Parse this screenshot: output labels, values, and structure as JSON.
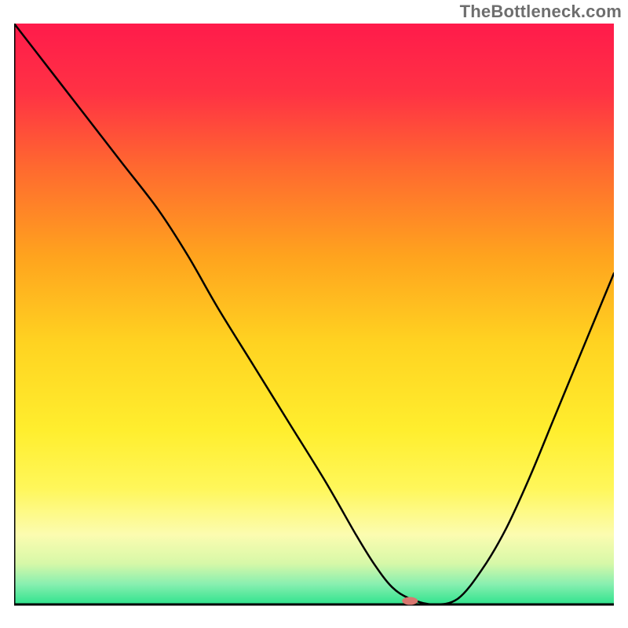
{
  "watermark": "TheBottleneck.com",
  "chart_data": {
    "type": "line",
    "title": "",
    "xlabel": "",
    "ylabel": "",
    "xlim": [
      0,
      100
    ],
    "ylim": [
      0,
      100
    ],
    "grid": false,
    "legend": false,
    "background_gradient": {
      "stops": [
        {
          "offset": 0.0,
          "color": "#ff1b4b"
        },
        {
          "offset": 0.12,
          "color": "#ff3244"
        },
        {
          "offset": 0.25,
          "color": "#ff6a2f"
        },
        {
          "offset": 0.4,
          "color": "#ffa31e"
        },
        {
          "offset": 0.55,
          "color": "#ffd321"
        },
        {
          "offset": 0.7,
          "color": "#ffee2e"
        },
        {
          "offset": 0.8,
          "color": "#fff75a"
        },
        {
          "offset": 0.88,
          "color": "#fcfcb0"
        },
        {
          "offset": 0.93,
          "color": "#d6f8a8"
        },
        {
          "offset": 0.965,
          "color": "#88efb0"
        },
        {
          "offset": 1.0,
          "color": "#2fe38d"
        }
      ]
    },
    "series": [
      {
        "name": "bottleneck-curve",
        "x": [
          0,
          6,
          12,
          18,
          24,
          29,
          34,
          40,
          46,
          52,
          57,
          60,
          63,
          66,
          70,
          74,
          78,
          82,
          86,
          90,
          94,
          98,
          100
        ],
        "y": [
          100,
          92,
          84,
          76,
          68,
          60,
          51,
          41,
          31,
          21,
          12,
          7,
          3,
          1,
          0,
          1,
          6,
          13,
          22,
          32,
          42,
          52,
          57
        ]
      }
    ],
    "marker": {
      "name": "optimal-point",
      "x": 66,
      "y": 0.6,
      "color": "#d97770",
      "rx": 10,
      "ry": 5
    },
    "axis_color": "#000000",
    "curve_color": "#000000"
  }
}
